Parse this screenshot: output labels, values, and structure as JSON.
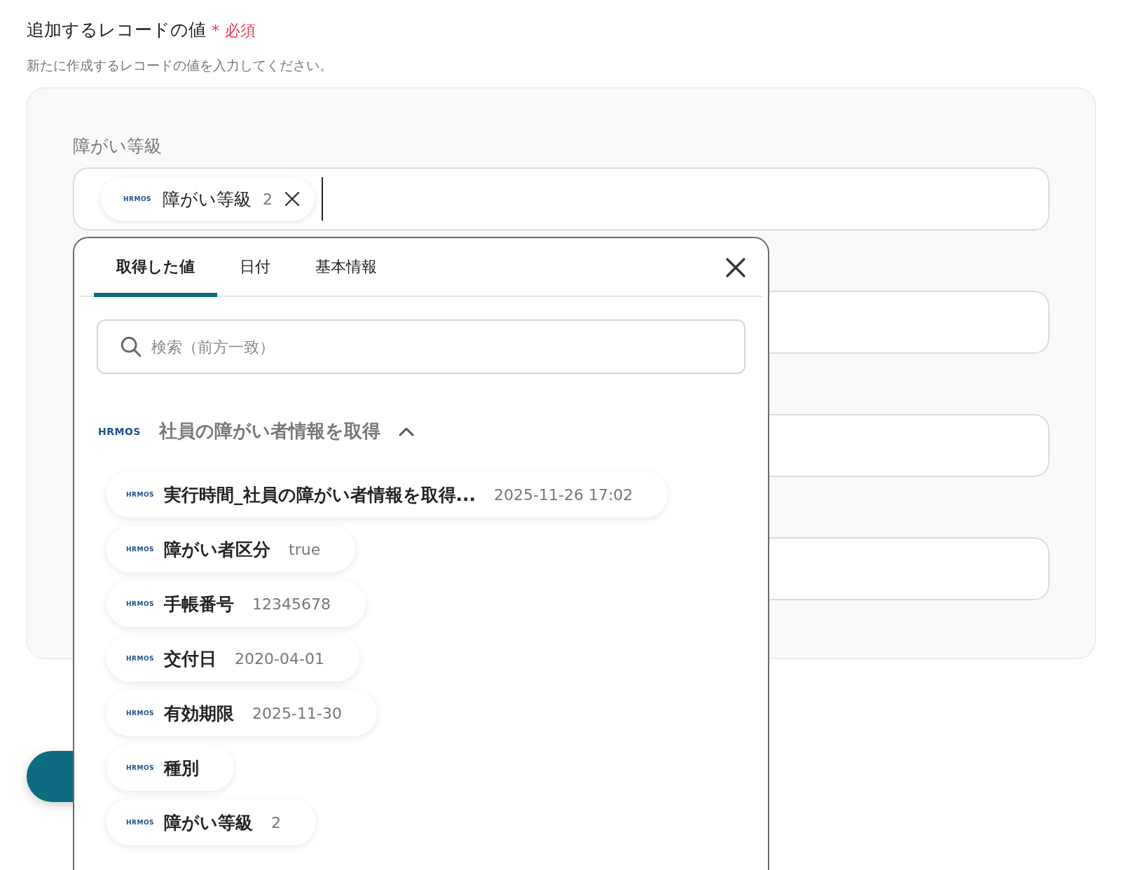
{
  "form": {
    "title": "追加するレコードの値",
    "required_mark": "*",
    "required_label": "必須",
    "description": "新たに作成するレコードの値を入力してください。",
    "fields": [
      {
        "kind": "chips",
        "label": "障がい等級",
        "chips": [
          {
            "logo": "HRMOS",
            "label": "障がい等級",
            "value": "2"
          }
        ]
      },
      {
        "kind": "empty"
      },
      {
        "kind": "empty"
      },
      {
        "kind": "empty"
      }
    ]
  },
  "popup": {
    "tabs": [
      {
        "label": "取得した値",
        "selected": true
      },
      {
        "label": "日付",
        "selected": false
      },
      {
        "label": "基本情報",
        "selected": false
      }
    ],
    "search": {
      "placeholder": "検索（前方一致）"
    },
    "group": {
      "logo": "HRMOS",
      "title": "社員の障がい者情報を取得",
      "expanded": true,
      "items": [
        {
          "logo": "HRMOS",
          "label": "実行時間_社員の障がい者情報を取得...",
          "value": "2025-11-26 17:02"
        },
        {
          "logo": "HRMOS",
          "label": "障がい者区分",
          "value": "true"
        },
        {
          "logo": "HRMOS",
          "label": "手帳番号",
          "value": "12345678"
        },
        {
          "logo": "HRMOS",
          "label": "交付日",
          "value": "2020-04-01"
        },
        {
          "logo": "HRMOS",
          "label": "有効期限",
          "value": "2025-11-30"
        },
        {
          "logo": "HRMOS",
          "label": "種別"
        },
        {
          "logo": "HRMOS",
          "label": "障がい等級",
          "value": "2"
        }
      ]
    }
  }
}
